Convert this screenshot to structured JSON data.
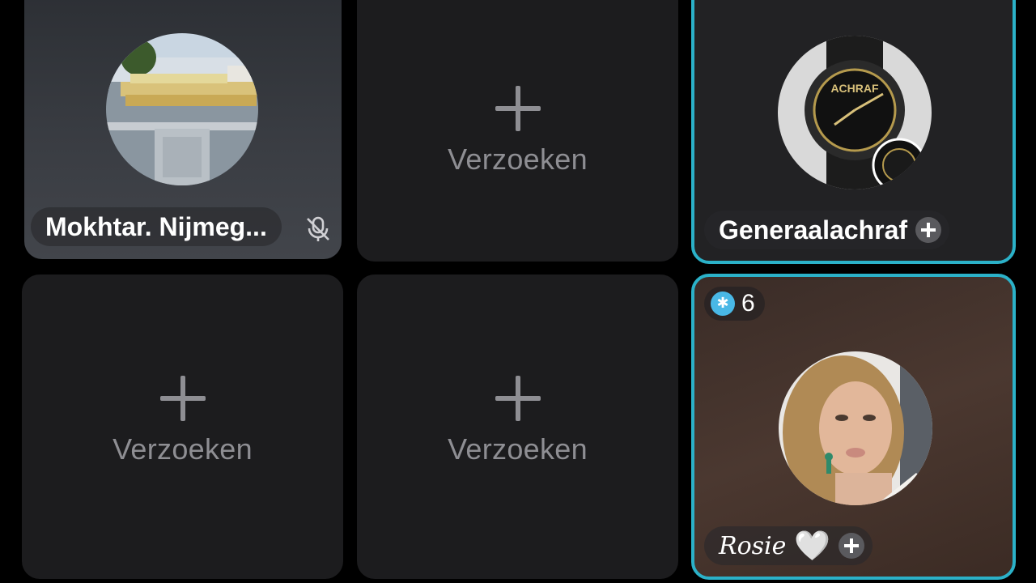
{
  "participants": [
    {
      "name": "Mokhtar. Nijmeg...",
      "muted": true,
      "avatar_icon": "avatar-boat-river"
    },
    {
      "name": "Generaalachraf",
      "has_add": true,
      "highlighted": true,
      "avatar_icon": "avatar-watch"
    },
    {
      "name": "Rosie",
      "name_suffix": "🤍",
      "has_add": true,
      "highlighted": true,
      "badge_count": "6",
      "badge_icon": "star-badge-icon",
      "avatar_icon": "avatar-woman"
    }
  ],
  "empty_slots": [
    {
      "label": "Verzoeken"
    },
    {
      "label": "Verzoeken"
    },
    {
      "label": "Verzoeken"
    }
  ],
  "colors": {
    "highlight_border": "#2bb1c8",
    "empty_tile": "#1c1c1e",
    "muted_text": "#8e8e93",
    "badge": "#49b8e6"
  }
}
